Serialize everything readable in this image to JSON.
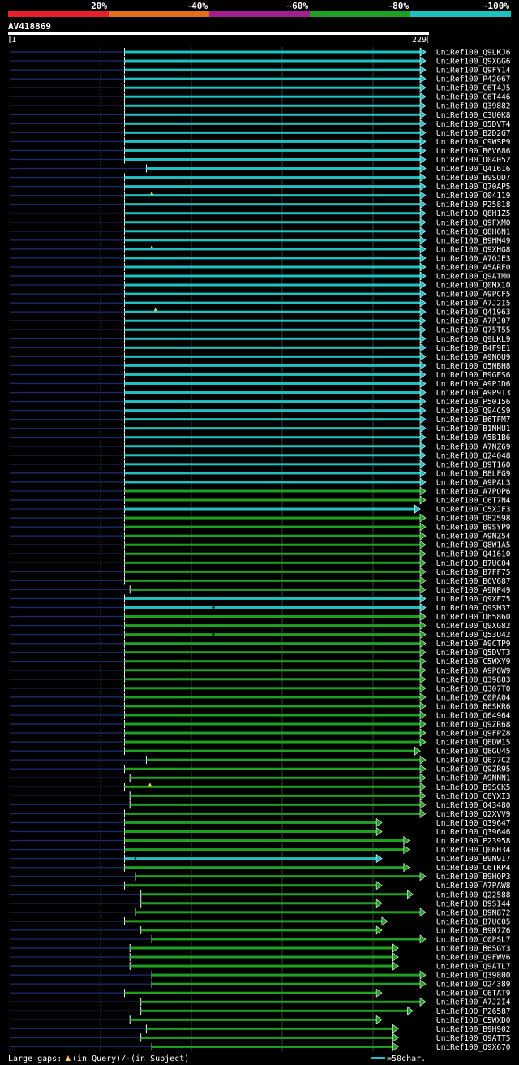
{
  "chart_data": {
    "type": "alignment-overview",
    "query": {
      "name": "AV418869",
      "start": 1,
      "end": 229
    },
    "identity_legend": [
      {
        "label": "20%",
        "color": "#e8202a"
      },
      {
        "label": "~40%",
        "color": "#e07020"
      },
      {
        "label": "~60%",
        "color": "#a02090"
      },
      {
        "label": "~80%",
        "color": "#20a020"
      },
      {
        "label": "~100%",
        "color": "#20c0c0"
      }
    ],
    "xlim": [
      1,
      229
    ],
    "colors": {
      "cyan": "#20c0c0",
      "green": "#20a020",
      "unaligned": "#1a2a66",
      "grid": "#2a4a2a"
    },
    "hits": [
      {
        "name": "UniRef100_Q9LKJ6",
        "s": 64,
        "e": 229,
        "c": "cyan"
      },
      {
        "name": "UniRef100_Q9XGG6",
        "s": 64,
        "e": 229,
        "c": "cyan"
      },
      {
        "name": "UniRef100_Q9FY14",
        "s": 64,
        "e": 229,
        "c": "cyan"
      },
      {
        "name": "UniRef100_P42067",
        "s": 64,
        "e": 229,
        "c": "cyan"
      },
      {
        "name": "UniRef100_C6T4J5",
        "s": 64,
        "e": 229,
        "c": "cyan"
      },
      {
        "name": "UniRef100_C6T446",
        "s": 64,
        "e": 229,
        "c": "cyan"
      },
      {
        "name": "UniRef100_Q39882",
        "s": 64,
        "e": 229,
        "c": "cyan"
      },
      {
        "name": "UniRef100_C3U0K8",
        "s": 64,
        "e": 229,
        "c": "cyan"
      },
      {
        "name": "UniRef100_Q5DVT4",
        "s": 64,
        "e": 229,
        "c": "cyan"
      },
      {
        "name": "UniRef100_B2D2G7",
        "s": 64,
        "e": 229,
        "c": "cyan"
      },
      {
        "name": "UniRef100_C9WSP9",
        "s": 64,
        "e": 229,
        "c": "cyan"
      },
      {
        "name": "UniRef100_B6V686",
        "s": 64,
        "e": 229,
        "c": "cyan"
      },
      {
        "name": "UniRef100_O04052",
        "s": 64,
        "e": 229,
        "c": "cyan"
      },
      {
        "name": "UniRef100_Q41616",
        "s": 76,
        "e": 229,
        "c": "cyan"
      },
      {
        "name": "UniRef100_B9SQD7",
        "s": 64,
        "e": 229,
        "c": "cyan"
      },
      {
        "name": "UniRef100_Q70AP5",
        "s": 64,
        "e": 229,
        "c": "cyan"
      },
      {
        "name": "UniRef100_O04119",
        "s": 64,
        "e": 229,
        "c": "cyan",
        "gap": 79
      },
      {
        "name": "UniRef100_P25818",
        "s": 64,
        "e": 229,
        "c": "cyan"
      },
      {
        "name": "UniRef100_Q8H1Z5",
        "s": 64,
        "e": 229,
        "c": "cyan"
      },
      {
        "name": "UniRef100_Q9FXM0",
        "s": 64,
        "e": 229,
        "c": "cyan"
      },
      {
        "name": "UniRef100_Q8H6N1",
        "s": 64,
        "e": 229,
        "c": "cyan"
      },
      {
        "name": "UniRef100_B9HM49",
        "s": 64,
        "e": 229,
        "c": "cyan"
      },
      {
        "name": "UniRef100_Q9XHG8",
        "s": 64,
        "e": 229,
        "c": "cyan",
        "gap": 79
      },
      {
        "name": "UniRef100_A7QJE3",
        "s": 64,
        "e": 229,
        "c": "cyan"
      },
      {
        "name": "UniRef100_A5ARF0",
        "s": 64,
        "e": 229,
        "c": "cyan"
      },
      {
        "name": "UniRef100_Q9ATM0",
        "s": 64,
        "e": 229,
        "c": "cyan"
      },
      {
        "name": "UniRef100_Q0MX10",
        "s": 64,
        "e": 229,
        "c": "cyan"
      },
      {
        "name": "UniRef100_A9PCF5",
        "s": 64,
        "e": 229,
        "c": "cyan"
      },
      {
        "name": "UniRef100_A7J2I5",
        "s": 64,
        "e": 229,
        "c": "cyan"
      },
      {
        "name": "UniRef100_Q41963",
        "s": 64,
        "e": 229,
        "c": "cyan",
        "gap": 81
      },
      {
        "name": "UniRef100_A7PJ07",
        "s": 64,
        "e": 229,
        "c": "cyan"
      },
      {
        "name": "UniRef100_Q75T55",
        "s": 64,
        "e": 229,
        "c": "cyan"
      },
      {
        "name": "UniRef100_Q9LKL9",
        "s": 64,
        "e": 229,
        "c": "cyan"
      },
      {
        "name": "UniRef100_B4F9E1",
        "s": 64,
        "e": 229,
        "c": "cyan"
      },
      {
        "name": "UniRef100_A9NQU9",
        "s": 64,
        "e": 229,
        "c": "cyan"
      },
      {
        "name": "UniRef100_Q5NBH8",
        "s": 64,
        "e": 229,
        "c": "cyan"
      },
      {
        "name": "UniRef100_B9GES6",
        "s": 64,
        "e": 229,
        "c": "cyan"
      },
      {
        "name": "UniRef100_A9PJD6",
        "s": 64,
        "e": 229,
        "c": "cyan"
      },
      {
        "name": "UniRef100_A9P9I3",
        "s": 64,
        "e": 229,
        "c": "cyan"
      },
      {
        "name": "UniRef100_P50156",
        "s": 64,
        "e": 229,
        "c": "cyan"
      },
      {
        "name": "UniRef100_Q94CS9",
        "s": 64,
        "e": 229,
        "c": "cyan"
      },
      {
        "name": "UniRef100_B6TFM7",
        "s": 64,
        "e": 229,
        "c": "cyan"
      },
      {
        "name": "UniRef100_B1NHU1",
        "s": 64,
        "e": 229,
        "c": "cyan"
      },
      {
        "name": "UniRef100_A5B1B6",
        "s": 64,
        "e": 229,
        "c": "cyan"
      },
      {
        "name": "UniRef100_A7NZ69",
        "s": 64,
        "e": 229,
        "c": "cyan"
      },
      {
        "name": "UniRef100_Q24048",
        "s": 64,
        "e": 229,
        "c": "cyan"
      },
      {
        "name": "UniRef100_B9T160",
        "s": 64,
        "e": 229,
        "c": "cyan"
      },
      {
        "name": "UniRef100_B8LFG9",
        "s": 64,
        "e": 229,
        "c": "cyan"
      },
      {
        "name": "UniRef100_A9PAL3",
        "s": 64,
        "e": 229,
        "c": "cyan"
      },
      {
        "name": "UniRef100_A7PQP6",
        "s": 64,
        "e": 229,
        "c": "green"
      },
      {
        "name": "UniRef100_C6T7N4",
        "s": 64,
        "e": 229,
        "c": "green"
      },
      {
        "name": "UniRef100_C5XJF3",
        "s": 64,
        "e": 226,
        "c": "cyan"
      },
      {
        "name": "UniRef100_O82598",
        "s": 64,
        "e": 229,
        "c": "green"
      },
      {
        "name": "UniRef100_B9SYP9",
        "s": 64,
        "e": 229,
        "c": "green"
      },
      {
        "name": "UniRef100_A9NZ54",
        "s": 64,
        "e": 229,
        "c": "green"
      },
      {
        "name": "UniRef100_Q8W1A5",
        "s": 64,
        "e": 229,
        "c": "green"
      },
      {
        "name": "UniRef100_Q41610",
        "s": 64,
        "e": 229,
        "c": "green"
      },
      {
        "name": "UniRef100_B7UC04",
        "s": 64,
        "e": 229,
        "c": "green"
      },
      {
        "name": "UniRef100_B7FF75",
        "s": 64,
        "e": 229,
        "c": "green"
      },
      {
        "name": "UniRef100_B6V687",
        "s": 64,
        "e": 229,
        "c": "green"
      },
      {
        "name": "UniRef100_A9NP49",
        "s": 67,
        "e": 229,
        "c": "green"
      },
      {
        "name": "UniRef100_Q9XF75",
        "s": 64,
        "e": 229,
        "c": "cyan"
      },
      {
        "name": "UniRef100_Q9SM37",
        "s": 64,
        "e": 229,
        "c": "cyan",
        "dot": 113
      },
      {
        "name": "UniRef100_O65860",
        "s": 64,
        "e": 229,
        "c": "green"
      },
      {
        "name": "UniRef100_Q9XG82",
        "s": 64,
        "e": 229,
        "c": "green"
      },
      {
        "name": "UniRef100_Q53U42",
        "s": 64,
        "e": 229,
        "c": "green",
        "dot": 113
      },
      {
        "name": "UniRef100_A9CTP9",
        "s": 64,
        "e": 229,
        "c": "green"
      },
      {
        "name": "UniRef100_Q5DVT3",
        "s": 64,
        "e": 229,
        "c": "green"
      },
      {
        "name": "UniRef100_C5WXY9",
        "s": 64,
        "e": 229,
        "c": "green"
      },
      {
        "name": "UniRef100_A9P8W9",
        "s": 64,
        "e": 229,
        "c": "green"
      },
      {
        "name": "UniRef100_Q39883",
        "s": 64,
        "e": 229,
        "c": "green"
      },
      {
        "name": "UniRef100_Q307T0",
        "s": 64,
        "e": 229,
        "c": "green"
      },
      {
        "name": "UniRef100_C0PA04",
        "s": 64,
        "e": 229,
        "c": "green"
      },
      {
        "name": "UniRef100_B6SKR6",
        "s": 64,
        "e": 229,
        "c": "green"
      },
      {
        "name": "UniRef100_O64964",
        "s": 64,
        "e": 229,
        "c": "green"
      },
      {
        "name": "UniRef100_Q9ZR68",
        "s": 64,
        "e": 229,
        "c": "green"
      },
      {
        "name": "UniRef100_Q9FPZ8",
        "s": 64,
        "e": 229,
        "c": "green"
      },
      {
        "name": "UniRef100_Q6DW15",
        "s": 64,
        "e": 229,
        "c": "green"
      },
      {
        "name": "UniRef100_Q8GU45",
        "s": 64,
        "e": 226,
        "c": "green"
      },
      {
        "name": "UniRef100_Q677C2",
        "s": 76,
        "e": 229,
        "c": "green"
      },
      {
        "name": "UniRef100_Q9ZR95",
        "s": 64,
        "e": 229,
        "c": "green"
      },
      {
        "name": "UniRef100_A9NNN1",
        "s": 67,
        "e": 229,
        "c": "green"
      },
      {
        "name": "UniRef100_B9SCK5",
        "s": 64,
        "e": 229,
        "c": "green",
        "gap": 78
      },
      {
        "name": "UniRef100_C8YXI3",
        "s": 67,
        "e": 229,
        "c": "green"
      },
      {
        "name": "UniRef100_O43480",
        "s": 67,
        "e": 229,
        "c": "green"
      },
      {
        "name": "UniRef100_Q2XVV9",
        "s": 64,
        "e": 229,
        "c": "green"
      },
      {
        "name": "UniRef100_Q39647",
        "s": 64,
        "e": 205,
        "c": "green"
      },
      {
        "name": "UniRef100_Q39646",
        "s": 64,
        "e": 205,
        "c": "green"
      },
      {
        "name": "UniRef100_P23958",
        "s": 64,
        "e": 220,
        "c": "green"
      },
      {
        "name": "UniRef100_Q06H34",
        "s": 64,
        "e": 220,
        "c": "green"
      },
      {
        "name": "UniRef100_B9N9I7",
        "s": 64,
        "e": 205,
        "c": "cyan",
        "dot": 70
      },
      {
        "name": "UniRef100_C6TKP4",
        "s": 64,
        "e": 220,
        "c": "green"
      },
      {
        "name": "UniRef100_B9HQP3",
        "s": 70,
        "e": 229,
        "c": "green"
      },
      {
        "name": "UniRef100_A7PAW8",
        "s": 64,
        "e": 205,
        "c": "green"
      },
      {
        "name": "UniRef100_Q22588",
        "s": 73,
        "e": 222,
        "c": "green"
      },
      {
        "name": "UniRef100_B9SI44",
        "s": 73,
        "e": 205,
        "c": "green"
      },
      {
        "name": "UniRef100_B9N872",
        "s": 70,
        "e": 229,
        "c": "green"
      },
      {
        "name": "UniRef100_B7UC05",
        "s": 64,
        "e": 208,
        "c": "green"
      },
      {
        "name": "UniRef100_B9N7Z6",
        "s": 73,
        "e": 205,
        "c": "green"
      },
      {
        "name": "UniRef100_C0PSL7",
        "s": 79,
        "e": 229,
        "c": "green"
      },
      {
        "name": "UniRef100_B6SGY3",
        "s": 67,
        "e": 214,
        "c": "green"
      },
      {
        "name": "UniRef100_Q9FWV6",
        "s": 67,
        "e": 214,
        "c": "green"
      },
      {
        "name": "UniRef100_Q9ATL7",
        "s": 67,
        "e": 214,
        "c": "green"
      },
      {
        "name": "UniRef100_Q39800",
        "s": 79,
        "e": 229,
        "c": "green"
      },
      {
        "name": "UniRef100_O24389",
        "s": 79,
        "e": 229,
        "c": "green"
      },
      {
        "name": "UniRef100_C6TAT9",
        "s": 64,
        "e": 205,
        "c": "green"
      },
      {
        "name": "UniRef100_A7J2I4",
        "s": 73,
        "e": 229,
        "c": "green"
      },
      {
        "name": "UniRef100_P26587",
        "s": 73,
        "e": 222,
        "c": "green"
      },
      {
        "name": "UniRef100_C5WXD0",
        "s": 67,
        "e": 205,
        "c": "green"
      },
      {
        "name": "UniRef100_B9H902",
        "s": 76,
        "e": 214,
        "c": "green"
      },
      {
        "name": "UniRef100_Q9ATT5",
        "s": 73,
        "e": 214,
        "c": "green"
      },
      {
        "name": "UniRef100_Q9X670",
        "s": 79,
        "e": 214,
        "c": "green"
      }
    ],
    "footer": {
      "label": "Large gaps:",
      "in_query": "(in Query)/",
      "dash": "-",
      "in_subject": " (in Subject)",
      "scale": "=50char."
    }
  }
}
